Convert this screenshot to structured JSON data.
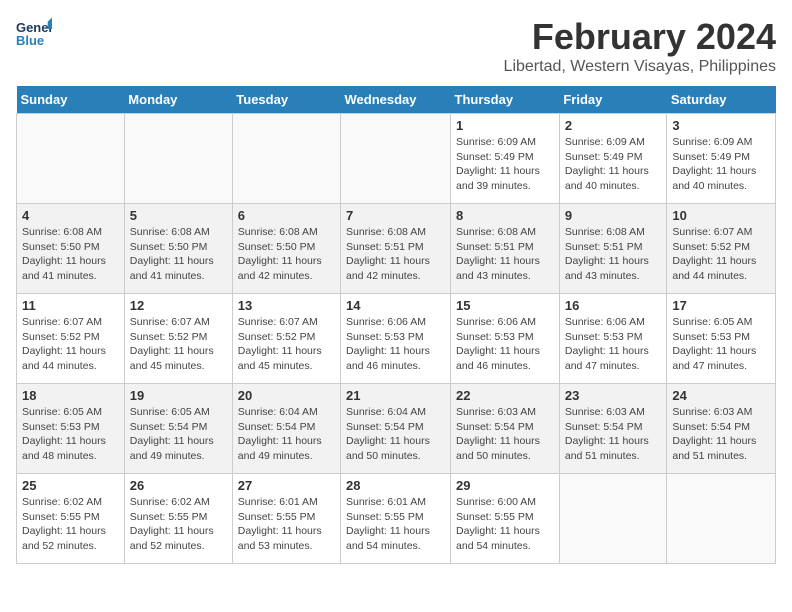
{
  "header": {
    "logo_text_general": "General",
    "logo_text_blue": "Blue",
    "month_title": "February 2024",
    "location": "Libertad, Western Visayas, Philippines"
  },
  "days_of_week": [
    "Sunday",
    "Monday",
    "Tuesday",
    "Wednesday",
    "Thursday",
    "Friday",
    "Saturday"
  ],
  "weeks": [
    {
      "shaded": false,
      "days": [
        {
          "num": "",
          "info": ""
        },
        {
          "num": "",
          "info": ""
        },
        {
          "num": "",
          "info": ""
        },
        {
          "num": "",
          "info": ""
        },
        {
          "num": "1",
          "info": "Sunrise: 6:09 AM\nSunset: 5:49 PM\nDaylight: 11 hours\nand 39 minutes."
        },
        {
          "num": "2",
          "info": "Sunrise: 6:09 AM\nSunset: 5:49 PM\nDaylight: 11 hours\nand 40 minutes."
        },
        {
          "num": "3",
          "info": "Sunrise: 6:09 AM\nSunset: 5:49 PM\nDaylight: 11 hours\nand 40 minutes."
        }
      ]
    },
    {
      "shaded": true,
      "days": [
        {
          "num": "4",
          "info": "Sunrise: 6:08 AM\nSunset: 5:50 PM\nDaylight: 11 hours\nand 41 minutes."
        },
        {
          "num": "5",
          "info": "Sunrise: 6:08 AM\nSunset: 5:50 PM\nDaylight: 11 hours\nand 41 minutes."
        },
        {
          "num": "6",
          "info": "Sunrise: 6:08 AM\nSunset: 5:50 PM\nDaylight: 11 hours\nand 42 minutes."
        },
        {
          "num": "7",
          "info": "Sunrise: 6:08 AM\nSunset: 5:51 PM\nDaylight: 11 hours\nand 42 minutes."
        },
        {
          "num": "8",
          "info": "Sunrise: 6:08 AM\nSunset: 5:51 PM\nDaylight: 11 hours\nand 43 minutes."
        },
        {
          "num": "9",
          "info": "Sunrise: 6:08 AM\nSunset: 5:51 PM\nDaylight: 11 hours\nand 43 minutes."
        },
        {
          "num": "10",
          "info": "Sunrise: 6:07 AM\nSunset: 5:52 PM\nDaylight: 11 hours\nand 44 minutes."
        }
      ]
    },
    {
      "shaded": false,
      "days": [
        {
          "num": "11",
          "info": "Sunrise: 6:07 AM\nSunset: 5:52 PM\nDaylight: 11 hours\nand 44 minutes."
        },
        {
          "num": "12",
          "info": "Sunrise: 6:07 AM\nSunset: 5:52 PM\nDaylight: 11 hours\nand 45 minutes."
        },
        {
          "num": "13",
          "info": "Sunrise: 6:07 AM\nSunset: 5:52 PM\nDaylight: 11 hours\nand 45 minutes."
        },
        {
          "num": "14",
          "info": "Sunrise: 6:06 AM\nSunset: 5:53 PM\nDaylight: 11 hours\nand 46 minutes."
        },
        {
          "num": "15",
          "info": "Sunrise: 6:06 AM\nSunset: 5:53 PM\nDaylight: 11 hours\nand 46 minutes."
        },
        {
          "num": "16",
          "info": "Sunrise: 6:06 AM\nSunset: 5:53 PM\nDaylight: 11 hours\nand 47 minutes."
        },
        {
          "num": "17",
          "info": "Sunrise: 6:05 AM\nSunset: 5:53 PM\nDaylight: 11 hours\nand 47 minutes."
        }
      ]
    },
    {
      "shaded": true,
      "days": [
        {
          "num": "18",
          "info": "Sunrise: 6:05 AM\nSunset: 5:53 PM\nDaylight: 11 hours\nand 48 minutes."
        },
        {
          "num": "19",
          "info": "Sunrise: 6:05 AM\nSunset: 5:54 PM\nDaylight: 11 hours\nand 49 minutes."
        },
        {
          "num": "20",
          "info": "Sunrise: 6:04 AM\nSunset: 5:54 PM\nDaylight: 11 hours\nand 49 minutes."
        },
        {
          "num": "21",
          "info": "Sunrise: 6:04 AM\nSunset: 5:54 PM\nDaylight: 11 hours\nand 50 minutes."
        },
        {
          "num": "22",
          "info": "Sunrise: 6:03 AM\nSunset: 5:54 PM\nDaylight: 11 hours\nand 50 minutes."
        },
        {
          "num": "23",
          "info": "Sunrise: 6:03 AM\nSunset: 5:54 PM\nDaylight: 11 hours\nand 51 minutes."
        },
        {
          "num": "24",
          "info": "Sunrise: 6:03 AM\nSunset: 5:54 PM\nDaylight: 11 hours\nand 51 minutes."
        }
      ]
    },
    {
      "shaded": false,
      "days": [
        {
          "num": "25",
          "info": "Sunrise: 6:02 AM\nSunset: 5:55 PM\nDaylight: 11 hours\nand 52 minutes."
        },
        {
          "num": "26",
          "info": "Sunrise: 6:02 AM\nSunset: 5:55 PM\nDaylight: 11 hours\nand 52 minutes."
        },
        {
          "num": "27",
          "info": "Sunrise: 6:01 AM\nSunset: 5:55 PM\nDaylight: 11 hours\nand 53 minutes."
        },
        {
          "num": "28",
          "info": "Sunrise: 6:01 AM\nSunset: 5:55 PM\nDaylight: 11 hours\nand 54 minutes."
        },
        {
          "num": "29",
          "info": "Sunrise: 6:00 AM\nSunset: 5:55 PM\nDaylight: 11 hours\nand 54 minutes."
        },
        {
          "num": "",
          "info": ""
        },
        {
          "num": "",
          "info": ""
        }
      ]
    }
  ]
}
